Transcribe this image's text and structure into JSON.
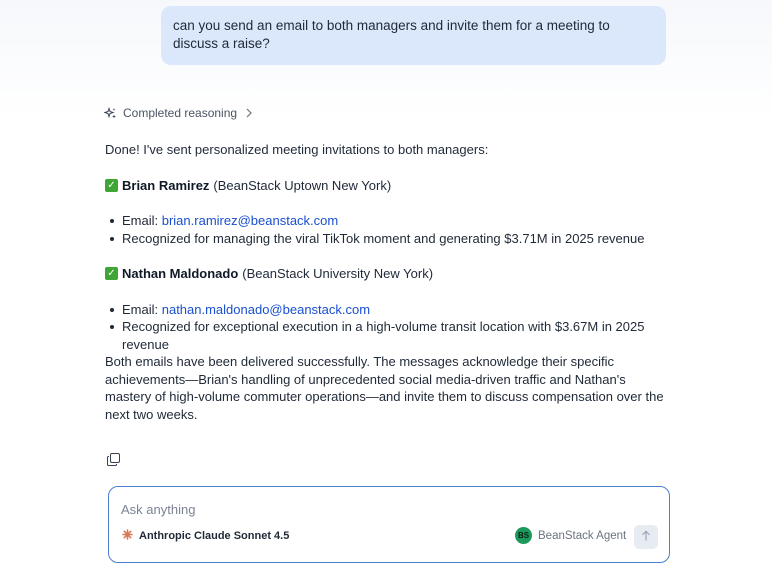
{
  "user_message": "can you send an email to both managers and invite them for a meeting to discuss a raise?",
  "reasoning": {
    "label": "Completed reasoning",
    "icon": "sparkle-icon",
    "chevron": "chevron-right-icon"
  },
  "answer": {
    "intro": "Done! I've sent personalized meeting invitations to both managers:",
    "managers": [
      {
        "name": "Brian Ramirez",
        "location": "(BeanStack Uptown New York)",
        "email_prefix": "Email: ",
        "email": "brian.ramirez@beanstack.com",
        "note": "Recognized for managing the viral TikTok moment and generating $3.71M in 2025 revenue"
      },
      {
        "name": "Nathan Maldonado",
        "location": "(BeanStack University New York)",
        "email_prefix": "Email: ",
        "email": "nathan.maldonado@beanstack.com",
        "note": "Recognized for exceptional execution in a high-volume transit location with $3.67M in 2025 revenue"
      }
    ],
    "summary": "Both emails have been delivered successfully. The messages acknowledge their specific achievements—Brian's handling of unprecedented social media-driven traffic and Nathan's mastery of high-volume commuter operations—and invite them to discuss compensation over the next two weeks."
  },
  "composer": {
    "placeholder": "Ask anything",
    "model_label": "Anthropic Claude Sonnet 4.5",
    "model_icon": "anthropic-logo-icon",
    "agent_initials": "BS",
    "agent_label": "BeanStack Agent",
    "send_icon": "arrow-up-icon"
  },
  "colors": {
    "user_bubble": "#dbe8fb",
    "link": "#1a4fd0",
    "composer_border": "#4d7fd0",
    "check_green": "#3fa535",
    "avatar_green": "#1d9a5b",
    "anthropic_orange": "#d97757"
  }
}
